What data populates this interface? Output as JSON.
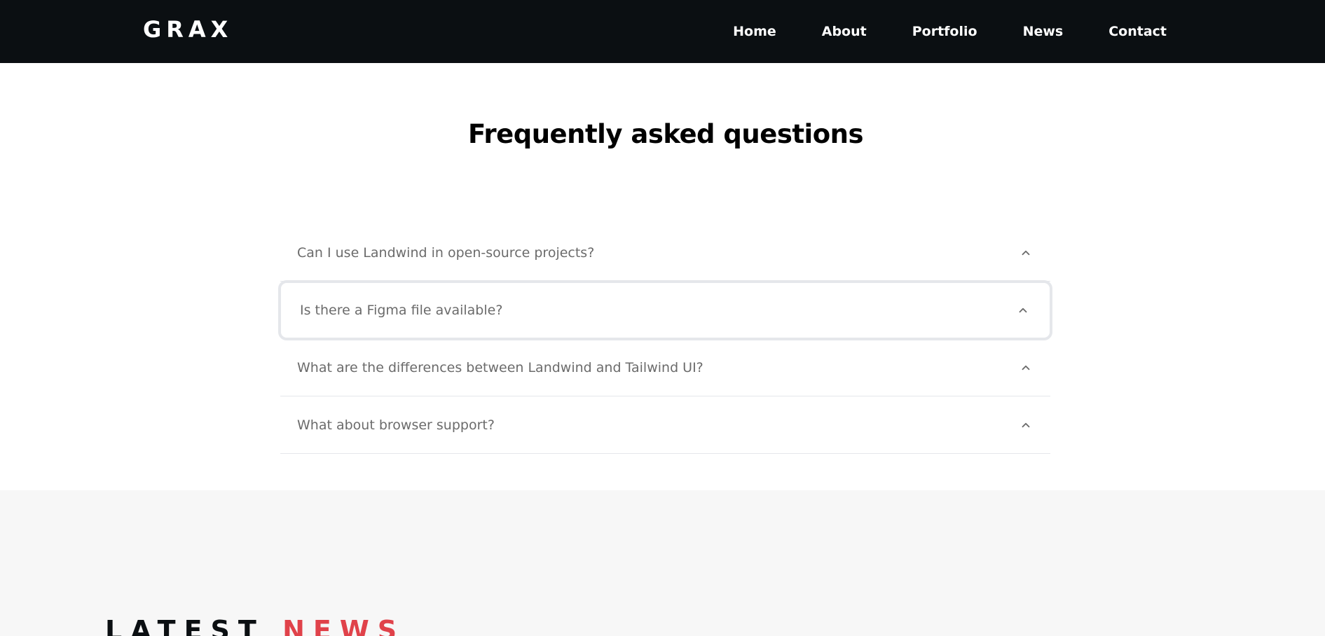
{
  "header": {
    "logo": "GRAX",
    "nav": [
      "Home",
      "About",
      "Portfolio",
      "News",
      "Contact"
    ]
  },
  "faq": {
    "title": "Frequently asked questions",
    "items": [
      {
        "question": "Can I use Landwind in open-source projects?",
        "icon": "chevron-up-icon"
      },
      {
        "question": "Is there a Figma file available?",
        "icon": "chevron-up-icon"
      },
      {
        "question": "What are the differences between Landwind and Tailwind UI?",
        "icon": "chevron-up-icon"
      },
      {
        "question": "What about browser support?",
        "icon": "chevron-up-icon"
      }
    ]
  },
  "news": {
    "title_word1": "LATEST",
    "title_word2": "NEWS"
  },
  "colors": {
    "navbar_bg": "#0b0f12",
    "accent_red": "#e0424a",
    "news_bg": "#f7f7f7",
    "question_text": "#6b6b6b"
  }
}
